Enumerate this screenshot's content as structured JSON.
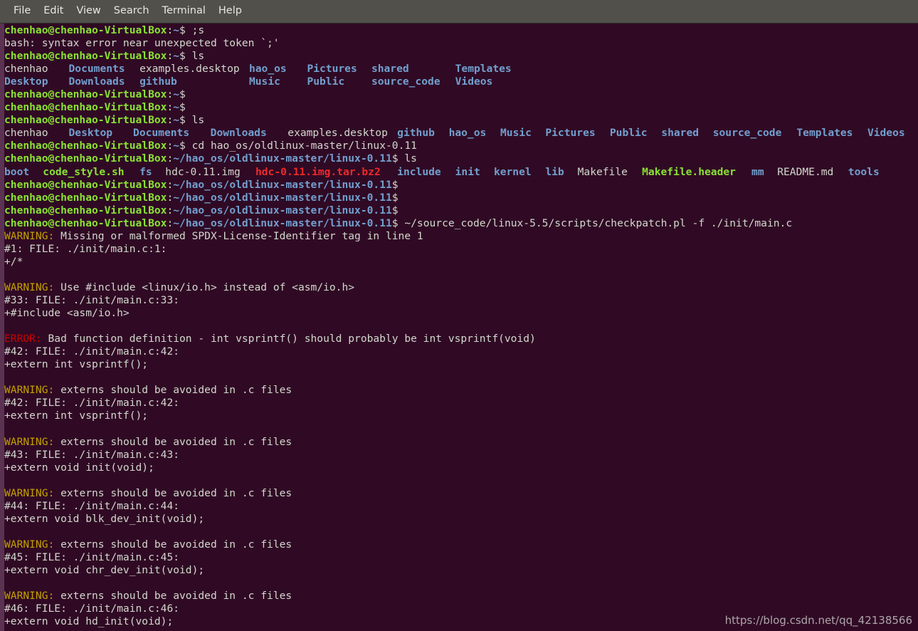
{
  "window": {
    "app": "gnome-terminal",
    "menu": [
      "File",
      "Edit",
      "View",
      "Search",
      "Terminal",
      "Help"
    ]
  },
  "theme": {
    "background": "#300a24",
    "foreground": "#d3d7cf",
    "menubar_background": "#51504a",
    "prompt_green": "#8ae234",
    "path_blue": "#729fcf",
    "dir_blue": "#729fcf",
    "exec_green": "#8ae234",
    "archive_red": "#ef2929",
    "warning_yellow": "#c4a000",
    "error_red": "#cc0000",
    "left_edge": "#5c3253"
  },
  "prompts": {
    "user_host": "chenhao@chenhao-VirtualBox",
    "home_path": "~",
    "work_path": "~/hao_os/oldlinux-master/linux-0.11",
    "sigil": "$"
  },
  "terminal": {
    "lines": [
      {
        "type": "prompt",
        "path": "home",
        "command": ";s"
      },
      {
        "type": "out",
        "text": "bash: syntax error near unexpected token `;'"
      },
      {
        "type": "prompt",
        "path": "home",
        "command": "ls"
      },
      {
        "type": "ls",
        "items": [
          {
            "name": "chenhao",
            "kind": "file",
            "col": 0
          },
          {
            "name": "Documents",
            "kind": "dir",
            "col": 10
          },
          {
            "name": "examples.desktop",
            "kind": "file",
            "col": 21
          },
          {
            "name": "hao_os",
            "kind": "dir",
            "col": 38
          },
          {
            "name": "Pictures",
            "kind": "dir",
            "col": 47
          },
          {
            "name": "shared",
            "kind": "dir",
            "col": 57
          },
          {
            "name": "Templates",
            "kind": "dir",
            "col": 70
          }
        ]
      },
      {
        "type": "ls",
        "items": [
          {
            "name": "Desktop",
            "kind": "dir",
            "col": 0
          },
          {
            "name": "Downloads",
            "kind": "dir",
            "col": 10
          },
          {
            "name": "github",
            "kind": "dir",
            "col": 21
          },
          {
            "name": "Music",
            "kind": "dir",
            "col": 38
          },
          {
            "name": "Public",
            "kind": "dir",
            "col": 47
          },
          {
            "name": "source_code",
            "kind": "dir",
            "col": 57
          },
          {
            "name": "Videos",
            "kind": "dir",
            "col": 70
          }
        ]
      },
      {
        "type": "prompt",
        "path": "home",
        "command": ""
      },
      {
        "type": "prompt",
        "path": "home",
        "command": ""
      },
      {
        "type": "prompt",
        "path": "home",
        "command": "ls"
      },
      {
        "type": "ls",
        "items": [
          {
            "name": "chenhao",
            "kind": "file",
            "col": 0
          },
          {
            "name": "Desktop",
            "kind": "dir",
            "col": 10
          },
          {
            "name": "Documents",
            "kind": "dir",
            "col": 20
          },
          {
            "name": "Downloads",
            "kind": "dir",
            "col": 32
          },
          {
            "name": "examples.desktop",
            "kind": "file",
            "col": 44
          },
          {
            "name": "github",
            "kind": "dir",
            "col": 61
          },
          {
            "name": "hao_os",
            "kind": "dir",
            "col": 69
          },
          {
            "name": "Music",
            "kind": "dir",
            "col": 77
          },
          {
            "name": "Pictures",
            "kind": "dir",
            "col": 84
          },
          {
            "name": "Public",
            "kind": "dir",
            "col": 94
          },
          {
            "name": "shared",
            "kind": "dir",
            "col": 102
          },
          {
            "name": "source_code",
            "kind": "dir",
            "col": 110
          },
          {
            "name": "Templates",
            "kind": "dir",
            "col": 123
          },
          {
            "name": "Videos",
            "kind": "dir",
            "col": 134
          }
        ]
      },
      {
        "type": "prompt",
        "path": "home",
        "command": "cd hao_os/oldlinux-master/linux-0.11"
      },
      {
        "type": "prompt",
        "path": "work",
        "command": "ls"
      },
      {
        "type": "ls",
        "items": [
          {
            "name": "boot",
            "kind": "dir",
            "col": 0
          },
          {
            "name": "code_style.sh",
            "kind": "exec",
            "col": 6
          },
          {
            "name": "fs",
            "kind": "dir",
            "col": 21
          },
          {
            "name": "hdc-0.11.img",
            "kind": "file",
            "col": 25
          },
          {
            "name": "hdc-0.11.img.tar.bz2",
            "kind": "archive",
            "col": 39
          },
          {
            "name": "include",
            "kind": "dir",
            "col": 61
          },
          {
            "name": "init",
            "kind": "dir",
            "col": 70
          },
          {
            "name": "kernel",
            "kind": "dir",
            "col": 76
          },
          {
            "name": "lib",
            "kind": "dir",
            "col": 84
          },
          {
            "name": "Makefile",
            "kind": "file",
            "col": 89
          },
          {
            "name": "Makefile.header",
            "kind": "exec",
            "col": 99
          },
          {
            "name": "mm",
            "kind": "dir",
            "col": 116
          },
          {
            "name": "README.md",
            "kind": "file",
            "col": 120
          },
          {
            "name": "tools",
            "kind": "dir",
            "col": 131
          }
        ]
      },
      {
        "type": "prompt",
        "path": "work",
        "command": ""
      },
      {
        "type": "prompt",
        "path": "work",
        "command": ""
      },
      {
        "type": "prompt",
        "path": "work",
        "command": ""
      },
      {
        "type": "prompt",
        "path": "work",
        "command": "~/source_code/linux-5.5/scripts/checkpatch.pl -f ./init/main.c"
      },
      {
        "type": "diag",
        "level": "WARNING",
        "message": "Missing or malformed SPDX-License-Identifier tag in line 1"
      },
      {
        "type": "out",
        "text": "#1: FILE: ./init/main.c:1:"
      },
      {
        "type": "out",
        "text": "+/*"
      },
      {
        "type": "blank"
      },
      {
        "type": "diag",
        "level": "WARNING",
        "message": "Use #include <linux/io.h> instead of <asm/io.h>"
      },
      {
        "type": "out",
        "text": "#33: FILE: ./init/main.c:33:"
      },
      {
        "type": "out",
        "text": "+#include <asm/io.h>"
      },
      {
        "type": "blank"
      },
      {
        "type": "diag",
        "level": "ERROR",
        "message": "Bad function definition - int vsprintf() should probably be int vsprintf(void)"
      },
      {
        "type": "out",
        "text": "#42: FILE: ./init/main.c:42:"
      },
      {
        "type": "out",
        "text": "+extern int vsprintf();"
      },
      {
        "type": "blank"
      },
      {
        "type": "diag",
        "level": "WARNING",
        "message": "externs should be avoided in .c files"
      },
      {
        "type": "out",
        "text": "#42: FILE: ./init/main.c:42:"
      },
      {
        "type": "out",
        "text": "+extern int vsprintf();"
      },
      {
        "type": "blank"
      },
      {
        "type": "diag",
        "level": "WARNING",
        "message": "externs should be avoided in .c files"
      },
      {
        "type": "out",
        "text": "#43: FILE: ./init/main.c:43:"
      },
      {
        "type": "out",
        "text": "+extern void init(void);"
      },
      {
        "type": "blank"
      },
      {
        "type": "diag",
        "level": "WARNING",
        "message": "externs should be avoided in .c files"
      },
      {
        "type": "out",
        "text": "#44: FILE: ./init/main.c:44:"
      },
      {
        "type": "out",
        "text": "+extern void blk_dev_init(void);"
      },
      {
        "type": "blank"
      },
      {
        "type": "diag",
        "level": "WARNING",
        "message": "externs should be avoided in .c files"
      },
      {
        "type": "out",
        "text": "#45: FILE: ./init/main.c:45:"
      },
      {
        "type": "out",
        "text": "+extern void chr_dev_init(void);"
      },
      {
        "type": "blank"
      },
      {
        "type": "diag",
        "level": "WARNING",
        "message": "externs should be avoided in .c files"
      },
      {
        "type": "out",
        "text": "#46: FILE: ./init/main.c:46:"
      },
      {
        "type": "out",
        "text": "+extern void hd_init(void);"
      }
    ]
  },
  "watermark": {
    "text": "https://blog.csdn.net/qq_42138566"
  }
}
